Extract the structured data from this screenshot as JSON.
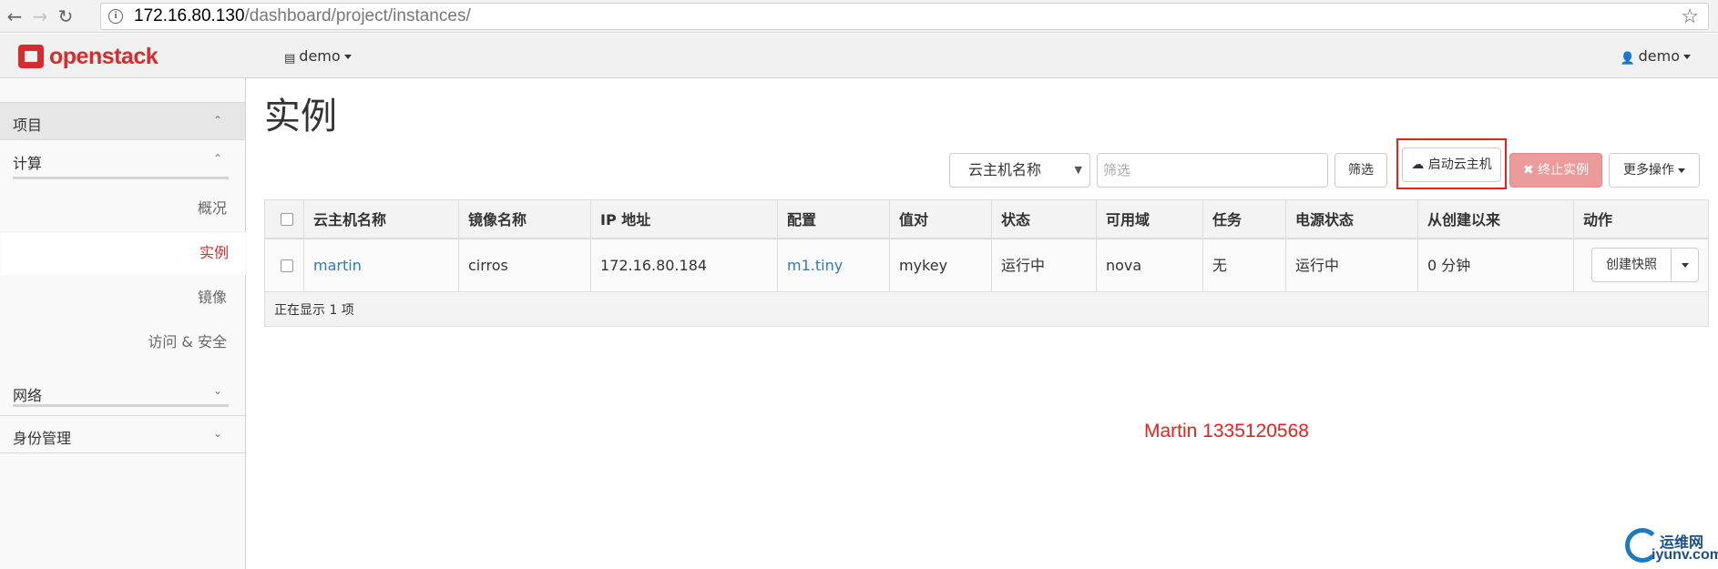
{
  "browser": {
    "url_host": "172.16.80.130",
    "url_path": "/dashboard/project/instances/",
    "back_icon": "←",
    "forward_icon": "→",
    "reload_icon": "↻",
    "info_icon": "i",
    "star_icon": "☆"
  },
  "topnav": {
    "logo_text": "openstack",
    "project": "demo",
    "user": "demo",
    "project_icon": "▤",
    "user_icon": "👤",
    "brand_color": "#d52d2d"
  },
  "sidebar": {
    "project_label": "项目",
    "compute_label": "计算",
    "compute_items": [
      {
        "label": "概况"
      },
      {
        "label": "实例",
        "active": true
      },
      {
        "label": "镜像"
      },
      {
        "label": "访问 & 安全"
      }
    ],
    "network_label": "网络",
    "identity_label": "身份管理",
    "chevron_up": "⌃",
    "chevron_down": "⌄"
  },
  "main": {
    "title": "实例",
    "filter_field": "云主机名称",
    "filter_placeholder": "筛选",
    "filter_button": "筛选",
    "launch_button": "启动云主机",
    "launch_icon": "☁",
    "terminate_button": "终止实例",
    "terminate_icon": "✖",
    "more_actions": "更多操作",
    "table": {
      "headers": [
        "云主机名称",
        "镜像名称",
        "IP 地址",
        "配置",
        "值对",
        "状态",
        "可用域",
        "任务",
        "电源状态",
        "从创建以来",
        "动作"
      ],
      "rows": [
        {
          "name": "martin",
          "image": "cirros",
          "ip": "172.16.80.184",
          "flavor": "m1.tiny",
          "keypair": "mykey",
          "status": "运行中",
          "zone": "nova",
          "task": "无",
          "power": "运行中",
          "age": "0 分钟",
          "action": "创建快照"
        }
      ],
      "footer": "正在显示 1 项"
    }
  },
  "watermark": {
    "text": "Martin 1335120568",
    "corner_cn": "运维网",
    "corner_en": "iyunv.com"
  },
  "colors": {
    "accent_red": "#e8221b",
    "link": "#337ab7",
    "terminate_bg": "#ec9a9a"
  }
}
